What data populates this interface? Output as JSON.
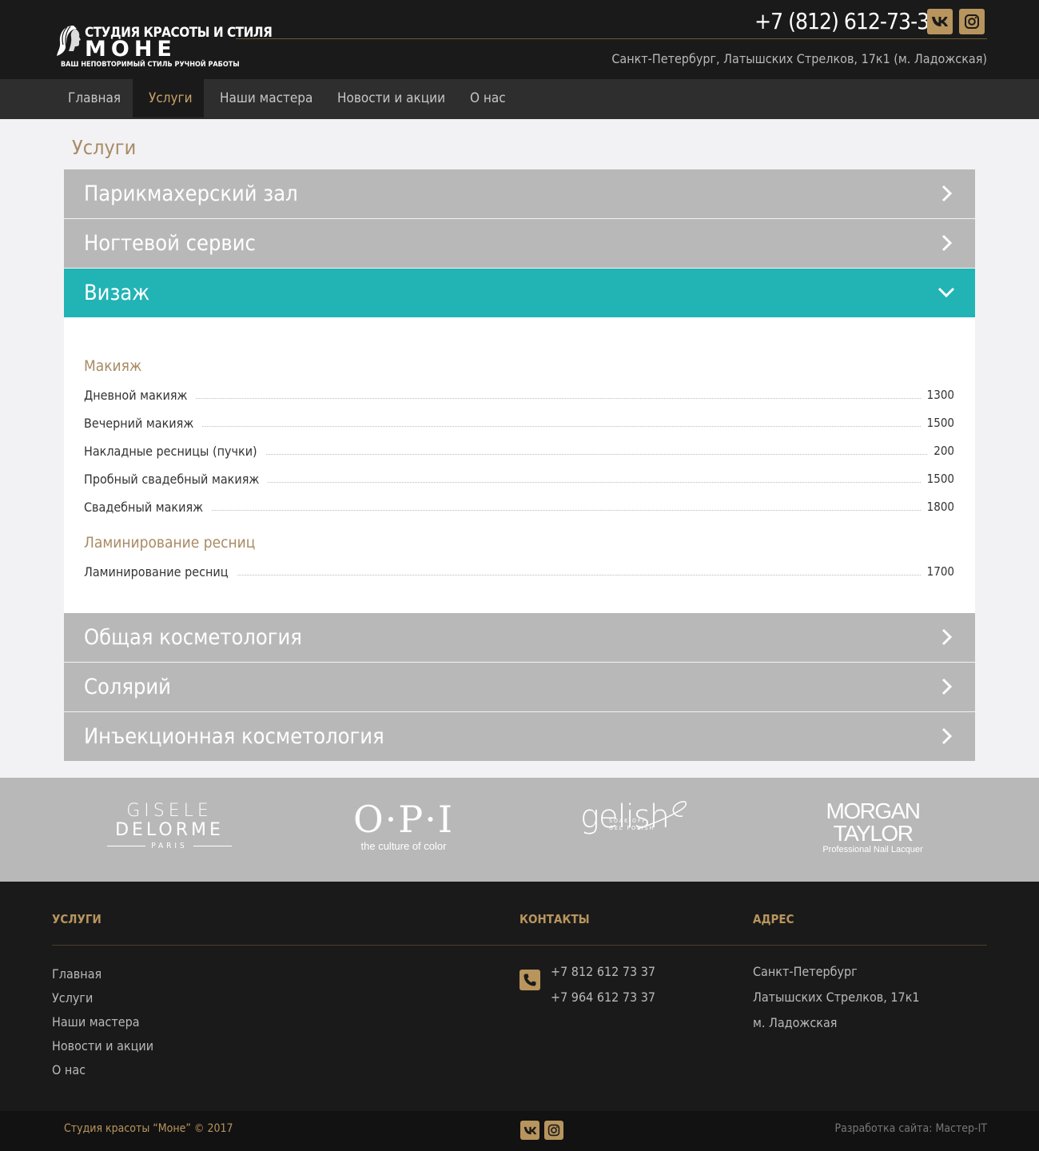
{
  "header": {
    "logo_top": "СТУДИЯ КРАСОТЫ И СТИЛЯ",
    "logo_main": "МОНЕ",
    "logo_sub": "ВАШ НЕПОВТОРИМЫЙ СТИЛЬ РУЧНОЙ РАБОТЫ",
    "phone": "+7 (812) 612-73-37",
    "address": "Санкт-Петербург, Латышских Стрелков, 17к1 (м. Ладожская)",
    "social_icons": [
      "vk-icon",
      "instagram-icon"
    ]
  },
  "nav": {
    "items": [
      {
        "label": "Главная"
      },
      {
        "label": "Услуги"
      },
      {
        "label": "Наши мастера"
      },
      {
        "label": "Новости и акции"
      },
      {
        "label": "О нас"
      }
    ],
    "active": "Услуги"
  },
  "main": {
    "title": "Услуги",
    "sections": [
      {
        "label": "Парикмахерский зал"
      },
      {
        "label": "Ногтевой сервис"
      },
      {
        "label": "Визаж"
      },
      {
        "label": "Общая косметология"
      },
      {
        "label": "Солярий"
      },
      {
        "label": "Инъекционная косметология"
      }
    ],
    "open_section": "Визаж",
    "groups": [
      {
        "title": "Макияж",
        "items": [
          {
            "name": "Дневной макияж",
            "price": "1300"
          },
          {
            "name": "Вечерний макияж",
            "price": "1500"
          },
          {
            "name": "Накладные ресницы (пучки)",
            "price": "200"
          },
          {
            "name": "Пробный свадебный макияж",
            "price": "1500"
          },
          {
            "name": "Свадебный макияж",
            "price": "1800"
          }
        ]
      },
      {
        "title": "Ламинирование ресниц",
        "items": [
          {
            "name": "Ламинирование ресниц",
            "price": "1700"
          }
        ]
      }
    ]
  },
  "brands": {
    "gisele_line1": "GISELE",
    "gisele_line2": "DELORME",
    "gisele_line3": "PARIS",
    "opi_name": "O·P·I",
    "opi_tagline": "the culture of color",
    "gelish_name": "gelish",
    "gelish_sub1": "SOAK-OFF",
    "gelish_sub2": "GEL POLISH",
    "morgan_line1": "MORGAN",
    "morgan_line2": "TAYLOR",
    "morgan_tagline": "Professional Nail Lacquer"
  },
  "footer": {
    "services_heading": "УСЛУГИ",
    "contacts_heading": "КОНТАКТЫ",
    "address_heading": "АДРЕС",
    "links": [
      "Главная",
      "Услуги",
      "Наши мастера",
      "Новости и акции",
      "О нас"
    ],
    "phones": [
      "+7 812 612 73 37",
      "+7 964 612 73 37"
    ],
    "address_lines": [
      "Санкт-Петербург",
      "Латышских Стрелков, 17к1",
      "м. Ладожская"
    ],
    "copyright": "Студия красоты “Моне” © 2017",
    "developer": "Разработка сайта: Мастер-IT"
  },
  "colors": {
    "accent": "#b8955d",
    "title_gold": "#a88b64",
    "teal": "#22b3b5",
    "accordion_gray": "#b8b8b8",
    "dark": "#1a1a1a"
  }
}
